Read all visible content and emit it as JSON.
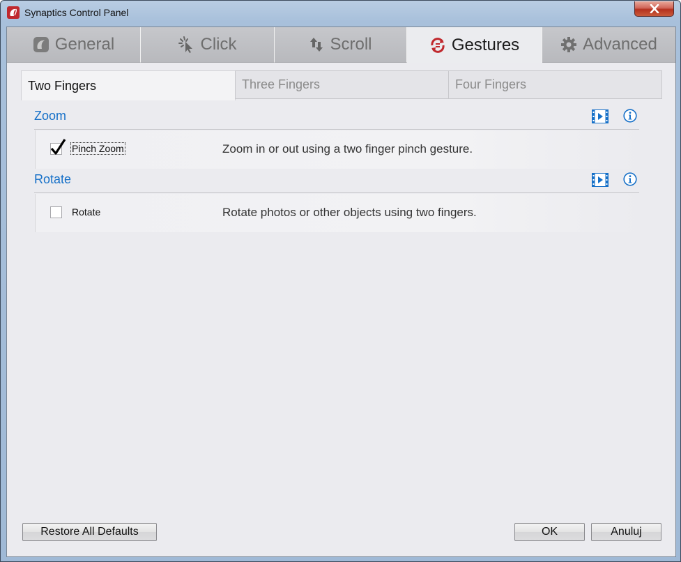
{
  "window": {
    "title": "Synaptics Control Panel"
  },
  "main_tabs": [
    {
      "label": "General",
      "icon": "general-icon"
    },
    {
      "label": "Click",
      "icon": "click-icon"
    },
    {
      "label": "Scroll",
      "icon": "scroll-icon"
    },
    {
      "label": "Gestures",
      "icon": "gestures-icon",
      "active": true
    },
    {
      "label": "Advanced",
      "icon": "gear-icon"
    }
  ],
  "sub_tabs": [
    {
      "label": "Two Fingers",
      "active": true
    },
    {
      "label": "Three Fingers"
    },
    {
      "label": "Four Fingers"
    }
  ],
  "sections": [
    {
      "title": "Zoom",
      "option": {
        "label": "Pinch Zoom",
        "checked": true,
        "description": "Zoom in or out using a two finger pinch gesture."
      }
    },
    {
      "title": "Rotate",
      "option": {
        "label": "Rotate",
        "checked": false,
        "description": "Rotate photos or other objects using two fingers."
      }
    }
  ],
  "buttons": {
    "restore": "Restore All Defaults",
    "ok": "OK",
    "cancel": "Anuluj"
  },
  "colors": {
    "accent": "#1670c8",
    "active_tab_icon": "#c0282d",
    "inactive_tab_text": "#6e6e6e"
  }
}
